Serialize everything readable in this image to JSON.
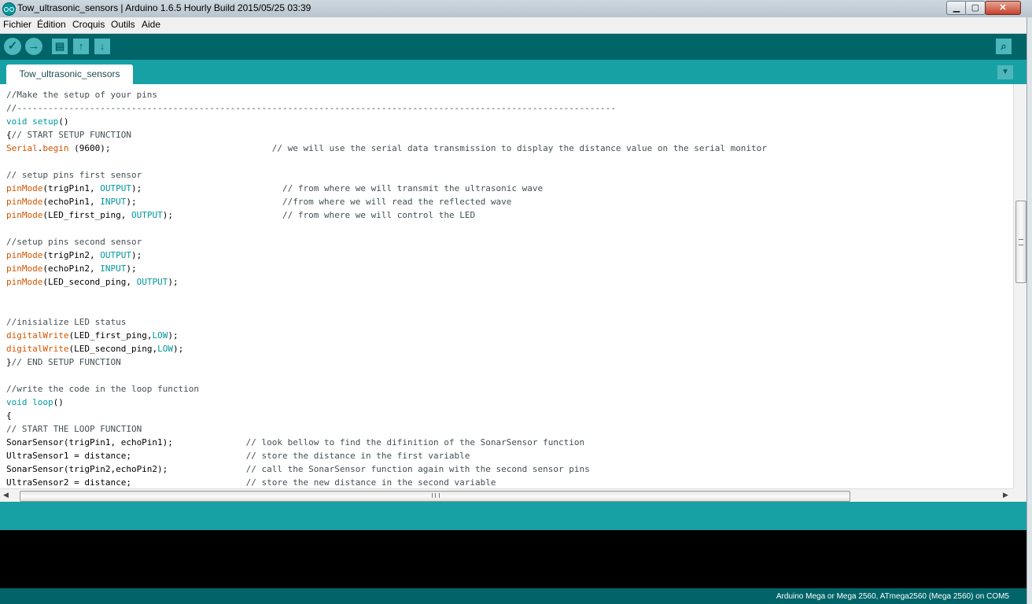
{
  "window": {
    "title": "Tow_ultrasonic_sensors | Arduino 1.6.5 Hourly Build 2015/05/25 03:39",
    "controls": {
      "minimize": "▁",
      "maximize": "▢",
      "close": "✕"
    }
  },
  "menu": {
    "items": [
      "Fichier",
      "Édition",
      "Croquis",
      "Outils",
      "Aide"
    ]
  },
  "toolbar": {
    "verify_icon": "✓",
    "upload_icon": "→",
    "new_icon": "▤",
    "open_icon": "↑",
    "save_icon": "↓",
    "serial_monitor_icon": "⌕"
  },
  "tabs": {
    "active": "Tow_ultrasonic_sensors",
    "menu_icon": "▼"
  },
  "editor": {
    "lines": [
      [
        {
          "t": "//Make the setup of your pins",
          "c": "comment"
        }
      ],
      [
        {
          "t": "//-------------------------------------------------------------------------------------------------------------------",
          "c": "comment"
        }
      ],
      [
        {
          "t": "void",
          "c": "kw"
        },
        {
          "t": " "
        },
        {
          "t": "setup",
          "c": "kw"
        },
        {
          "t": "()"
        }
      ],
      [
        {
          "t": "{"
        },
        {
          "t": "// START SETUP FUNCTION",
          "c": "comment"
        }
      ],
      [
        {
          "t": "Serial",
          "c": "fn"
        },
        {
          "t": "."
        },
        {
          "t": "begin",
          "c": "fn"
        },
        {
          "t": " (9600);                               "
        },
        {
          "t": "// we will use the serial data transmission to display the distance value on the serial monitor",
          "c": "comment"
        }
      ],
      [
        {
          "t": ""
        }
      ],
      [
        {
          "t": "// setup pins first sensor",
          "c": "comment"
        }
      ],
      [
        {
          "t": "pinMode",
          "c": "fn"
        },
        {
          "t": "(trigPin1, "
        },
        {
          "t": "OUTPUT",
          "c": "const"
        },
        {
          "t": ");                           "
        },
        {
          "t": "// from where we will transmit the ultrasonic wave",
          "c": "comment"
        }
      ],
      [
        {
          "t": "pinMode",
          "c": "fn"
        },
        {
          "t": "(echoPin1, "
        },
        {
          "t": "INPUT",
          "c": "const"
        },
        {
          "t": ");                            "
        },
        {
          "t": "//from where we will read the reflected wave",
          "c": "comment"
        }
      ],
      [
        {
          "t": "pinMode",
          "c": "fn"
        },
        {
          "t": "(LED_first_ping, "
        },
        {
          "t": "OUTPUT",
          "c": "const"
        },
        {
          "t": ");                     "
        },
        {
          "t": "// from where we will control the LED",
          "c": "comment"
        }
      ],
      [
        {
          "t": ""
        }
      ],
      [
        {
          "t": "//setup pins second sensor",
          "c": "comment"
        }
      ],
      [
        {
          "t": "pinMode",
          "c": "fn"
        },
        {
          "t": "(trigPin2, "
        },
        {
          "t": "OUTPUT",
          "c": "const"
        },
        {
          "t": ");"
        }
      ],
      [
        {
          "t": "pinMode",
          "c": "fn"
        },
        {
          "t": "(echoPin2, "
        },
        {
          "t": "INPUT",
          "c": "const"
        },
        {
          "t": ");"
        }
      ],
      [
        {
          "t": "pinMode",
          "c": "fn"
        },
        {
          "t": "(LED_second_ping, "
        },
        {
          "t": "OUTPUT",
          "c": "const"
        },
        {
          "t": ");"
        }
      ],
      [
        {
          "t": ""
        }
      ],
      [
        {
          "t": ""
        }
      ],
      [
        {
          "t": "//inisialize LED status",
          "c": "comment"
        }
      ],
      [
        {
          "t": "digitalWrite",
          "c": "fn"
        },
        {
          "t": "(LED_first_ping,"
        },
        {
          "t": "LOW",
          "c": "const"
        },
        {
          "t": ");"
        }
      ],
      [
        {
          "t": "digitalWrite",
          "c": "fn"
        },
        {
          "t": "(LED_second_ping,"
        },
        {
          "t": "LOW",
          "c": "const"
        },
        {
          "t": ");"
        }
      ],
      [
        {
          "t": "}"
        },
        {
          "t": "// END SETUP FUNCTION",
          "c": "comment"
        }
      ],
      [
        {
          "t": ""
        }
      ],
      [
        {
          "t": "//write the code in the loop function",
          "c": "comment"
        }
      ],
      [
        {
          "t": "void",
          "c": "kw"
        },
        {
          "t": " "
        },
        {
          "t": "loop",
          "c": "kw"
        },
        {
          "t": "()"
        }
      ],
      [
        {
          "t": "{"
        }
      ],
      [
        {
          "t": "// START THE LOOP FUNCTION",
          "c": "comment"
        }
      ],
      [
        {
          "t": "SonarSensor(trigPin1, echoPin1);              "
        },
        {
          "t": "// look bellow to find the difinition of the SonarSensor function",
          "c": "comment"
        }
      ],
      [
        {
          "t": "UltraSensor1 = distance;                      "
        },
        {
          "t": "// store the distance in the first variable",
          "c": "comment"
        }
      ],
      [
        {
          "t": "SonarSensor(trigPin2,echoPin2);               "
        },
        {
          "t": "// call the SonarSensor function again with the second sensor pins",
          "c": "comment"
        }
      ],
      [
        {
          "t": "UltraSensor2 = distance;                      "
        },
        {
          "t": "// store the new distance in the second variable",
          "c": "comment"
        }
      ]
    ]
  },
  "scrollbars": {
    "left_arrow": "◀",
    "right_arrow": "▶"
  },
  "status": {
    "board": "Arduino Mega or Mega 2560, ATmega2560 (Mega 2560) on COM5"
  }
}
